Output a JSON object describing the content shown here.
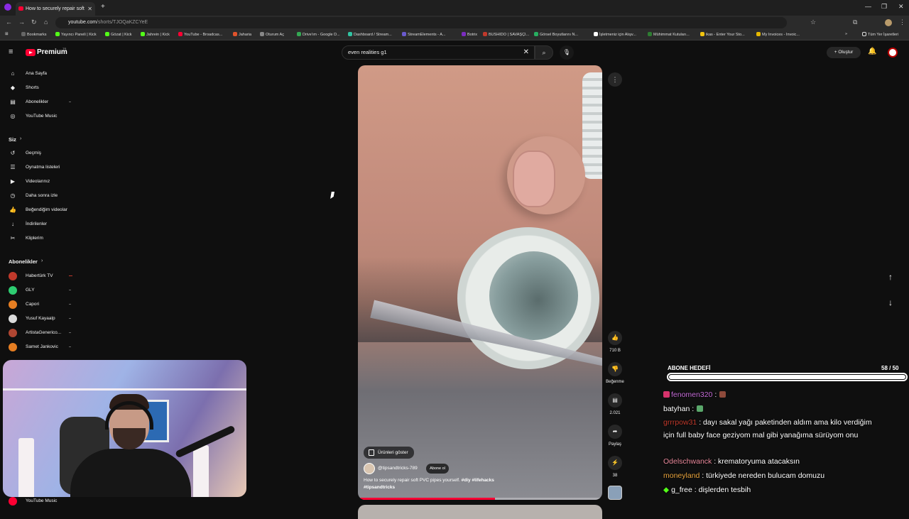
{
  "browser": {
    "tab_title": "How to securely repair soft",
    "url_host": "youtube.com",
    "url_path": "/shorts/TJOQaKZCYeE",
    "all_bookmarks_label": "Tüm Yer İşaretleri",
    "bookmarks": [
      {
        "label": "Bookmarks",
        "color": "#666666"
      },
      {
        "label": "Yayıncı Paneli | Kick",
        "color": "#53fc18"
      },
      {
        "label": "Gözat | Kick",
        "color": "#53fc18"
      },
      {
        "label": "Jahrein | Kick",
        "color": "#53fc18"
      },
      {
        "label": "YouTube - Broadcas...",
        "color": "#ff0033"
      },
      {
        "label": "Jaharia",
        "color": "#e0532c"
      },
      {
        "label": "Oturum Aç",
        "color": "#888888"
      },
      {
        "label": "Drive'ım - Google D...",
        "color": "#34a853"
      },
      {
        "label": "Dashboard / Stream...",
        "color": "#31c3a2"
      },
      {
        "label": "StreamElements - A...",
        "color": "#6a5acd"
      },
      {
        "label": "Botrix",
        "color": "#7b2cbf"
      },
      {
        "label": "BUSHIDO | SAVAŞÇI...",
        "color": "#c0392b"
      },
      {
        "label": "Görsel Boyutlarını N...",
        "color": "#27ae60"
      },
      {
        "label": "İşletmeniz için Alışv...",
        "color": "#ffffff"
      },
      {
        "label": "Mühimmat Kutuları...",
        "color": "#2e7d32"
      },
      {
        "label": "ikas - Enter Your Sto...",
        "color": "#f1c40f"
      },
      {
        "label": "My Invoices - Invoic...",
        "color": "#e6b800"
      }
    ]
  },
  "header": {
    "logo_text": "Premium",
    "logo_tr": "TR",
    "search_value": "even realities g1",
    "create_label": "Oluştur"
  },
  "sidebar": {
    "main_items": [
      {
        "label": "Ana Sayfa",
        "icon": "home-icon",
        "glyph": "⌂"
      },
      {
        "label": "Shorts",
        "icon": "shorts-icon",
        "glyph": "◆"
      },
      {
        "label": "Abonelikler",
        "icon": "subscriptions-icon",
        "glyph": "▤"
      },
      {
        "label": "YouTube Music",
        "icon": "music-icon",
        "glyph": "◎"
      }
    ],
    "you_heading": "Siz",
    "you_items": [
      {
        "label": "Geçmiş",
        "icon": "history-icon",
        "glyph": "↺"
      },
      {
        "label": "Oynatma listeleri",
        "icon": "playlists-icon",
        "glyph": "☰"
      },
      {
        "label": "Videolarınız",
        "icon": "your-videos-icon",
        "glyph": "▶"
      },
      {
        "label": "Daha sonra izle",
        "icon": "watch-later-icon",
        "glyph": "◷"
      },
      {
        "label": "Beğendiğim videolar",
        "icon": "liked-icon",
        "glyph": "👍"
      },
      {
        "label": "İndirilenler",
        "icon": "downloads-icon",
        "glyph": "↓"
      },
      {
        "label": "Kliplerim",
        "icon": "clips-icon",
        "glyph": "✂"
      }
    ],
    "subs_heading": "Abonelikler",
    "subs": [
      {
        "label": "Habertürk TV",
        "color": "#c0392b"
      },
      {
        "label": "GLY",
        "color": "#2ecc71"
      },
      {
        "label": "Capori",
        "color": "#e67e22"
      },
      {
        "label": "Yusuf Kayaalp",
        "color": "#dcdcdc"
      },
      {
        "label": "ArtistaGenerico...",
        "color": "#b04632"
      },
      {
        "label": "Samet Jankovic",
        "color": "#e67e22"
      }
    ],
    "bottom_item": "YouTube Music"
  },
  "video": {
    "products_label": "Ürünleri göster",
    "channel": "@tipsandtricks-789",
    "subscribe_label": "Abone ol",
    "description": "How to securely repair soft PVC pipes yourself.",
    "hashtags_inline": "#diy #lifehacks",
    "hashtags_line2": "#tipsandtricks",
    "progress": 0.56
  },
  "actions": {
    "likes": "710 B",
    "dislike_label": "Beğenme",
    "comments": "2.021",
    "share_label": "Paylaş",
    "remix_count": "38"
  },
  "overlay": {
    "goal_title": "ABONE HEDEFİ",
    "goal_count": "58 / 50",
    "goal_fraction": 1.0,
    "chat": [
      {
        "user": "fenomen320",
        "color": "#c46bd6",
        "text": ":",
        "emote": true
      },
      {
        "user": "batyhan",
        "color": "#ffffff",
        "text": ":",
        "emote": true
      },
      {
        "user": "grrrpow31",
        "color": "#c0392b",
        "text": ": dayı sakal yağı paketinden aldım ama kilo verdiğim için full baby face geziyom mal gibi yanağıma sürüyom onu",
        "emote": false
      },
      {
        "user": "Odelschwanck",
        "color": "#e8889a",
        "text": ": krematoryuma atacaksın",
        "emote": false
      },
      {
        "user": "moneyland",
        "color": "#e8a33c",
        "text": ": türkiyede nereden bulucam domuzu",
        "emote": false
      },
      {
        "user": "g_free",
        "color": "#ffffff",
        "text": ": dişlerden tesbih",
        "emote": false
      }
    ]
  }
}
